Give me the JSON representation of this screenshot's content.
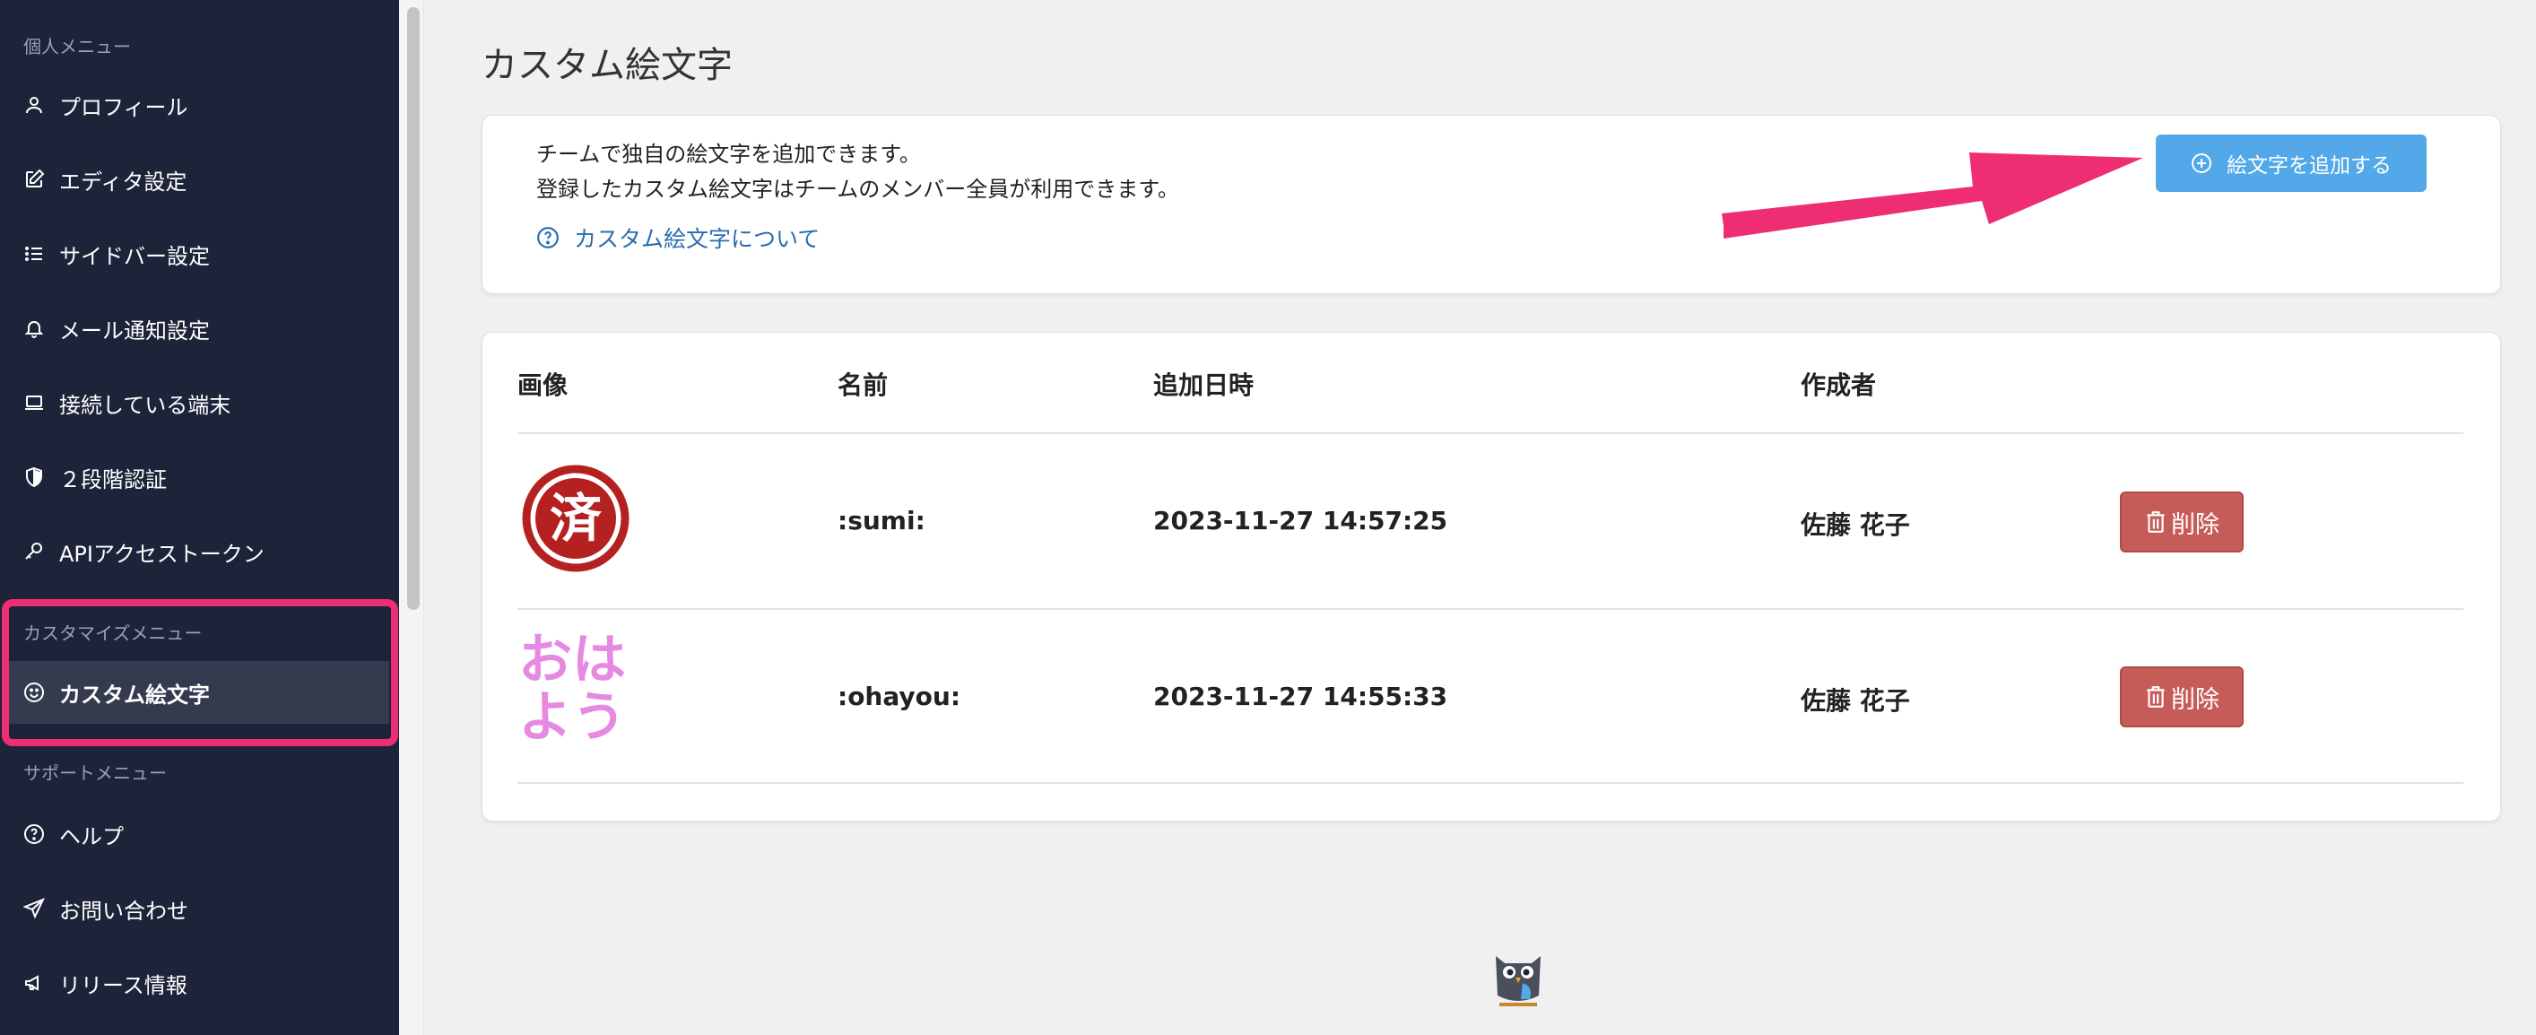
{
  "sidebar": {
    "personal_heading": "個人メニュー",
    "personal_items": [
      {
        "label": "プロフィール",
        "icon": "user-icon"
      },
      {
        "label": "エディタ設定",
        "icon": "edit-icon"
      },
      {
        "label": "サイドバー設定",
        "icon": "list-icon"
      },
      {
        "label": "メール通知設定",
        "icon": "bell-icon"
      },
      {
        "label": "接続している端末",
        "icon": "laptop-icon"
      },
      {
        "label": "２段階認証",
        "icon": "shield-icon"
      },
      {
        "label": "APIアクセストークン",
        "icon": "key-icon"
      }
    ],
    "customize_heading": "カスタマイズメニュー",
    "customize_items": [
      {
        "label": "カスタム絵文字",
        "icon": "smile-icon"
      }
    ],
    "support_heading": "サポートメニュー",
    "support_items": [
      {
        "label": "ヘルプ",
        "icon": "question-icon"
      },
      {
        "label": "お問い合わせ",
        "icon": "send-icon"
      },
      {
        "label": "リリース情報",
        "icon": "megaphone-icon"
      }
    ]
  },
  "main": {
    "title": "カスタム絵文字",
    "info_line1": "チームで独自の絵文字を追加できます。",
    "info_line2": "登録したカスタム絵文字はチームのメンバー全員が利用できます。",
    "help_link": "カスタム絵文字について",
    "add_button": "絵文字を追加する"
  },
  "table": {
    "headers": [
      "画像",
      "名前",
      "追加日時",
      "作成者"
    ],
    "rows": [
      {
        "image_text": "済",
        "name": ":sumi:",
        "date": "2023-11-27 14:57:25",
        "author": "佐藤 花子",
        "delete": "削除"
      },
      {
        "image_text_1": "おは",
        "image_text_2": "よう",
        "name": ":ohayou:",
        "date": "2023-11-27 14:55:33",
        "author": "佐藤 花子",
        "delete": "削除"
      }
    ]
  },
  "colors": {
    "sidebar_bg": "#1d2439",
    "highlight": "#ef2d73",
    "add_button": "#52a8e8",
    "delete_button": "#c65c58",
    "link": "#2b6cb0",
    "sumi_red": "#b52020",
    "ohayou_pink": "#e58ae0"
  }
}
